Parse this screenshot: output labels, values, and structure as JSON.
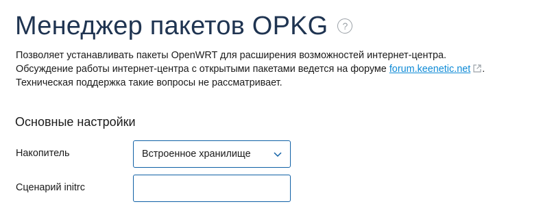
{
  "page": {
    "title": "Менеджер пакетов OPKG",
    "help_glyph": "?"
  },
  "description": {
    "line1": "Позволяет устанавливать пакеты OpenWRT для расширения возможностей интернет-центра.",
    "line2_before": "Обсуждение работы интернет-центра с открытыми пакетами ведется на форуме ",
    "link_text": "forum.keenetic.net",
    "line2_after": ". Техническая поддержка такие вопросы не рассматривает."
  },
  "section": {
    "title": "Основные настройки"
  },
  "form": {
    "storage_label": "Накопитель",
    "storage_value": "Встроенное хранилище",
    "initrc_label": "Сценарий initrc",
    "initrc_value": ""
  },
  "icons": {
    "help": "help-circle-icon",
    "external_link": "external-link-icon",
    "dropdown": "chevron-down-icon"
  },
  "colors": {
    "title": "#1f3451",
    "link": "#0e8ad6",
    "field_border": "#0e5fa5"
  }
}
